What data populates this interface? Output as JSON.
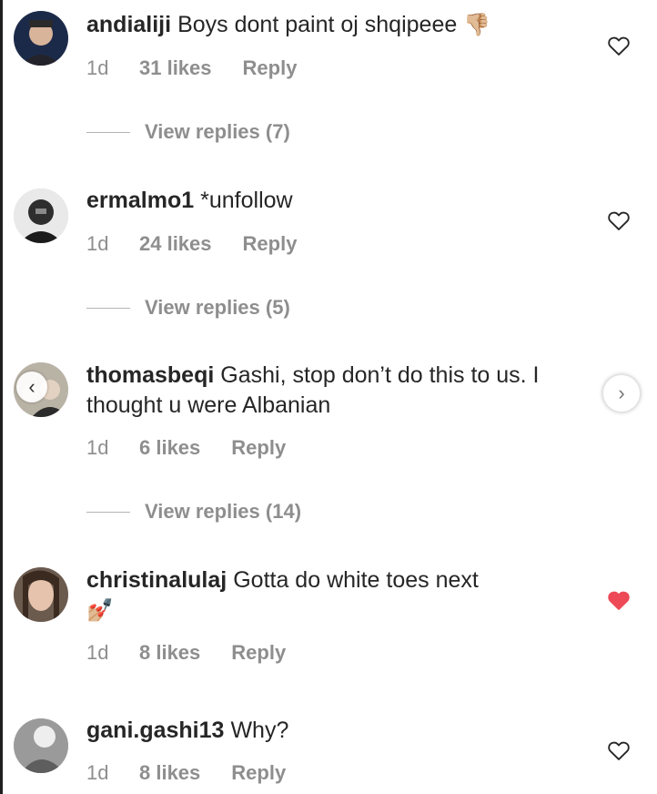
{
  "comments": [
    {
      "username": "andialiji",
      "text": "Boys dont paint oj shqipeee",
      "emoji": "👎🏼",
      "age": "1d",
      "likes": "31 likes",
      "reply": "Reply",
      "view_replies": "View replies (7)",
      "liked": false
    },
    {
      "username": "ermalmo1",
      "text": "*unfollow",
      "emoji": "",
      "age": "1d",
      "likes": "24 likes",
      "reply": "Reply",
      "view_replies": "View replies (5)",
      "liked": false
    },
    {
      "username": "thomasbeqi",
      "text": "Gashi, stop don’t do this to us. I thought u were Albanian",
      "emoji": "",
      "age": "1d",
      "likes": "6 likes",
      "reply": "Reply",
      "view_replies": "View replies (14)",
      "liked": false
    },
    {
      "username": "christinalulaj",
      "text": "Gotta do white toes next",
      "emoji": "💅🏼",
      "age": "1d",
      "likes": "8 likes",
      "reply": "Reply",
      "view_replies": "",
      "liked": true
    },
    {
      "username": "gani.gashi13",
      "text": "Why?",
      "emoji": "",
      "age": "1d",
      "likes": "8 likes",
      "reply": "Reply",
      "view_replies": "",
      "liked": false
    }
  ],
  "colors": {
    "text": "#262626",
    "meta": "#8e8e8e",
    "like_red": "#ed4956"
  },
  "icons": {
    "heart": "heart-outline-icon",
    "heart_filled": "heart-filled-icon",
    "back": "chevron-left-icon",
    "next": "chevron-right-icon"
  }
}
